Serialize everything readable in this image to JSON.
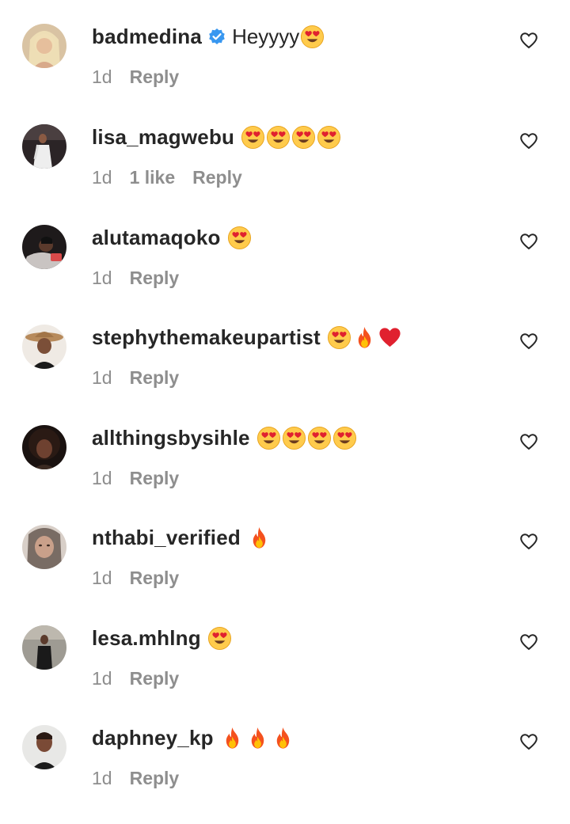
{
  "comments": [
    {
      "username": "badmedina",
      "verified": true,
      "text": "Heyyyy",
      "emojis": [
        "heart-eyes-emoji"
      ],
      "time": "1d",
      "likes": "",
      "reply_label": "Reply"
    },
    {
      "username": "lisa_magwebu",
      "verified": false,
      "text": "",
      "emojis": [
        "heart-eyes-emoji",
        "heart-eyes-emoji",
        "heart-eyes-emoji",
        "heart-eyes-emoji"
      ],
      "time": "1d",
      "likes": "1 like",
      "reply_label": "Reply"
    },
    {
      "username": "alutamaqoko",
      "verified": false,
      "text": "",
      "emojis": [
        "heart-eyes-emoji"
      ],
      "time": "1d",
      "likes": "",
      "reply_label": "Reply"
    },
    {
      "username": "stephythemakeupartist",
      "verified": false,
      "text": "",
      "emojis": [
        "heart-eyes-emoji",
        "fire-emoji",
        "red-heart-emoji"
      ],
      "time": "1d",
      "likes": "",
      "reply_label": "Reply"
    },
    {
      "username": "allthingsbysihle",
      "verified": false,
      "text": "",
      "emojis": [
        "heart-eyes-emoji",
        "heart-eyes-emoji",
        "heart-eyes-emoji",
        "heart-eyes-emoji"
      ],
      "time": "1d",
      "likes": "",
      "reply_label": "Reply"
    },
    {
      "username": "nthabi_verified",
      "verified": false,
      "text": "",
      "emojis": [
        "fire-emoji"
      ],
      "time": "1d",
      "likes": "",
      "reply_label": "Reply"
    },
    {
      "username": "lesa.mhlng",
      "verified": false,
      "text": "",
      "emojis": [
        "heart-eyes-emoji"
      ],
      "time": "1d",
      "likes": "",
      "reply_label": "Reply"
    },
    {
      "username": "daphney_kp",
      "verified": false,
      "text": "",
      "emojis": [
        "fire-emoji",
        "fire-emoji",
        "fire-emoji"
      ],
      "time": "1d",
      "likes": "",
      "reply_label": "Reply"
    }
  ],
  "colors": {
    "text": "#262626",
    "secondary_text": "#8e8e8e",
    "verified_badge": "#3897f0",
    "emoji_face": "#ffcb4c",
    "emoji_heart": "#e0212f",
    "fire_outer": "#f4511e",
    "fire_inner": "#ffc107"
  }
}
